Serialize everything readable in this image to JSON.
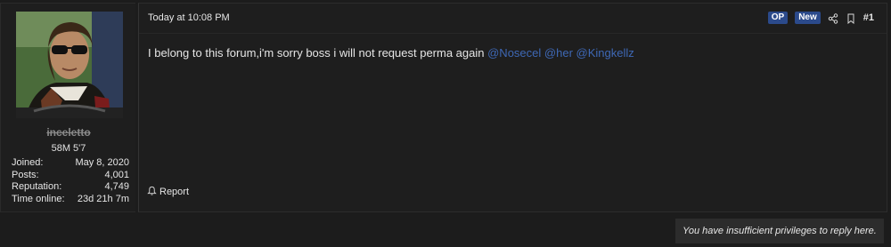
{
  "user": {
    "username": "inceletto",
    "title": "58M 5'7",
    "stats": [
      {
        "label": "Joined:",
        "value": "May 8, 2020"
      },
      {
        "label": "Posts:",
        "value": "4,001"
      },
      {
        "label": "Reputation:",
        "value": "4,749"
      },
      {
        "label": "Time online:",
        "value": "23d 21h 7m"
      }
    ]
  },
  "post": {
    "timestamp": "Today at 10:08 PM",
    "badges": {
      "op": "OP",
      "new": "New"
    },
    "number": "#1",
    "body": "I belong to this forum,i'm sorry boss i will not request perma again",
    "mentions": [
      "@Nosecel",
      "@her",
      "@Kingkellz"
    ],
    "report_label": "Report"
  },
  "footer": {
    "no_privileges": "You have insufficient privileges to reply here."
  },
  "colors": {
    "background": "#1c1c1c",
    "panel": "#1e1e1e",
    "badge": "#2b4a8b",
    "mention": "#3e68b5"
  },
  "icons": [
    "share-icon",
    "bookmark-icon",
    "bell-icon"
  ]
}
